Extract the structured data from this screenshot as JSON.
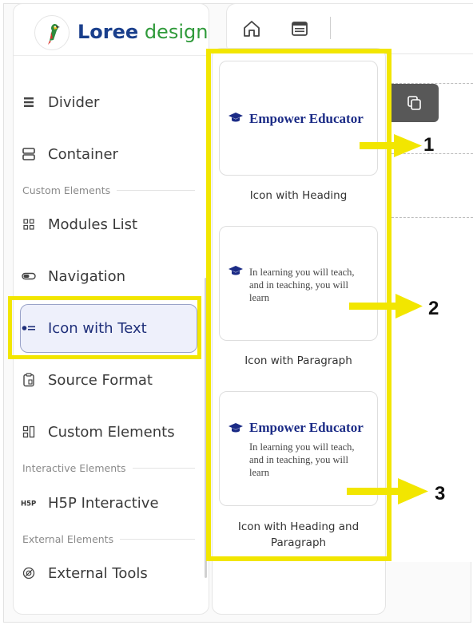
{
  "brand": {
    "name_bold": "Loree",
    "name_light": "design"
  },
  "sidebar": {
    "items": [
      {
        "label": "Divider",
        "icon": "divider-icon"
      },
      {
        "label": "Container",
        "icon": "container-icon"
      },
      {
        "label": "Modules List",
        "icon": "modules-list-icon"
      },
      {
        "label": "Navigation",
        "icon": "navigation-icon"
      },
      {
        "label": "Icon with Text",
        "icon": "icon-with-text-icon",
        "active": true
      },
      {
        "label": "Source Format",
        "icon": "source-format-icon"
      },
      {
        "label": "Custom Elements",
        "icon": "custom-elements-icon"
      },
      {
        "label": "H5P Interactive",
        "icon": "h5p-icon"
      },
      {
        "label": "External Tools",
        "icon": "external-tools-icon"
      }
    ],
    "sections": {
      "custom": "Custom Elements",
      "interactive": "Interactive Elements",
      "external": "External Elements"
    }
  },
  "toolbar": {
    "icons": [
      "home-icon",
      "template-icon"
    ]
  },
  "templates": [
    {
      "heading": "Empower Educator",
      "paragraph": "",
      "label": "Icon with Heading"
    },
    {
      "heading": "",
      "paragraph": "In learning you will teach, and in teaching, you will learn",
      "label": "Icon with Paragraph"
    },
    {
      "heading": "Empower Educator",
      "paragraph": "In learning you will teach, and in teaching, you will learn",
      "label": "Icon with Heading and Paragraph"
    }
  ],
  "annotations": [
    "1",
    "2",
    "3"
  ],
  "colors": {
    "highlight": "#f2e600",
    "brand_blue": "#1a3f8c",
    "brand_green": "#2f9a3a",
    "heading_navy": "#1b2b86",
    "active_bg": "#eef0fb"
  }
}
